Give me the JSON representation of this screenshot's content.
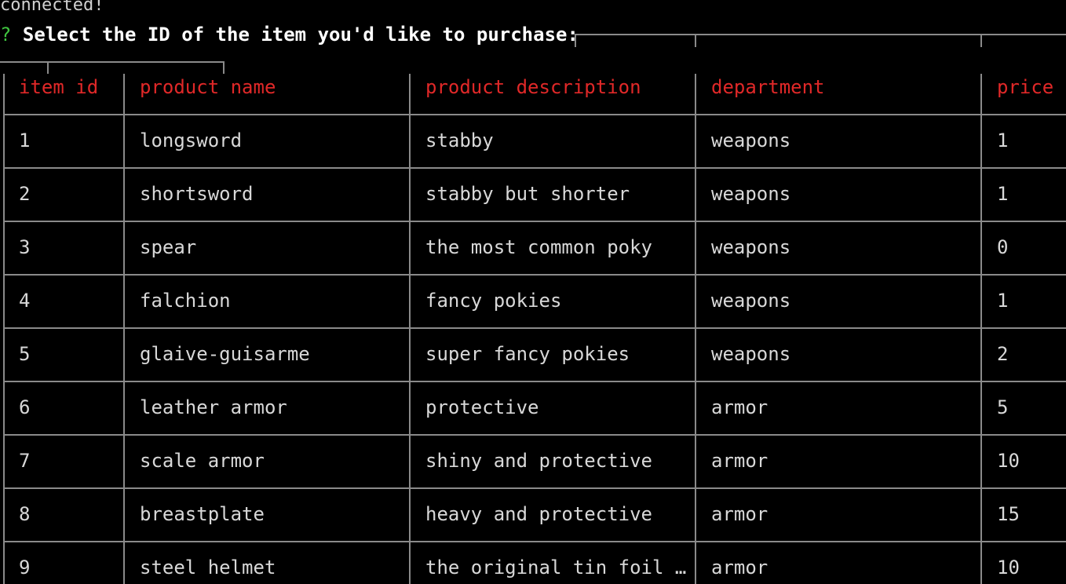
{
  "status_line": "connected!",
  "prompt": {
    "mark": "?",
    "question": " Select the ID of the item you'd like to purchase:"
  },
  "table": {
    "headers": [
      "item id",
      "product name",
      "product description",
      "department",
      "price"
    ],
    "rows": [
      [
        "1",
        "longsword",
        "stabby",
        "weapons",
        "1"
      ],
      [
        "2",
        "shortsword",
        "stabby but shorter",
        "weapons",
        "1"
      ],
      [
        "3",
        "spear",
        "the most common poky",
        "weapons",
        "0"
      ],
      [
        "4",
        "falchion",
        "fancy pokies",
        "weapons",
        "1"
      ],
      [
        "5",
        "glaive-guisarme",
        "super fancy pokies",
        "weapons",
        "2"
      ],
      [
        "6",
        "leather armor",
        "protective",
        "armor",
        "5"
      ],
      [
        "7",
        "scale armor",
        "shiny and protective",
        "armor",
        "10"
      ],
      [
        "8",
        "breastplate",
        "heavy and protective",
        "armor",
        "15"
      ],
      [
        "9",
        "steel helmet",
        "the original tin foil …",
        "armor",
        "10"
      ]
    ]
  },
  "colors": {
    "header_text": "#e02828",
    "prompt_mark": "#3fc43f",
    "body_text": "#d8d8d8",
    "border": "#8a8a8a",
    "background": "#000000"
  }
}
